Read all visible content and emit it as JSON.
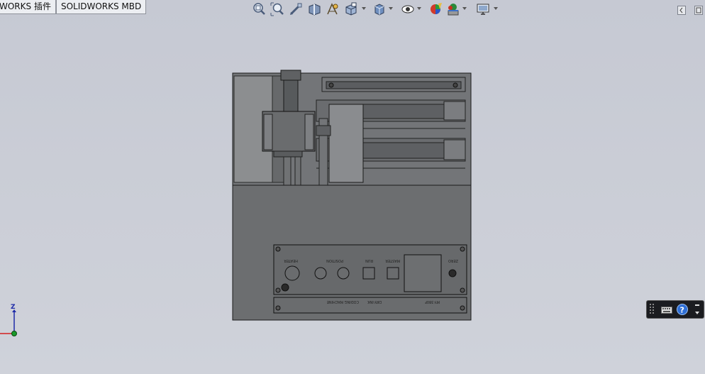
{
  "tabs": [
    {
      "label": "WORKS 插件"
    },
    {
      "label": "SOLIDWORKS MBD"
    }
  ],
  "hud_icons": [
    "zoom-to-fit-icon",
    "zoom-to-area-icon",
    "previous-view-icon",
    "section-view-icon",
    "dynamic-annotation-icon",
    "view-orientation-icon",
    "display-style-icon",
    "hide-show-items-icon",
    "edit-appearance-icon",
    "apply-scene-icon",
    "view-settings-icon"
  ],
  "triad": {
    "axis_label": "Z"
  },
  "panel_labels": {
    "heater": "HEATER",
    "position": "POSITION",
    "run": "RUN",
    "master": "MASTER",
    "zero": "ZERO",
    "model_no": "MY-380F",
    "dry_ink": "DRY-INK",
    "coding_machine": "CODING MACHINE"
  },
  "colors": {
    "background": "#c9ccd4",
    "model_fill": "#6d6f71",
    "model_light": "#8d8f91",
    "edge": "#1a1a1a"
  }
}
